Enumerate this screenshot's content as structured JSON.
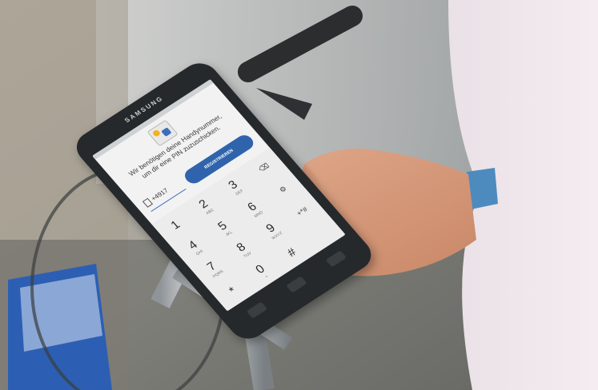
{
  "phone": {
    "brand": "SAMSUNG",
    "screen": {
      "message": "Wir benötigen deine Handynummer, um dir eine PIN zuzuschicken.",
      "phone_input_value": "+4917",
      "register_button": "REGISTRIEREN",
      "keypad": [
        {
          "main": "1",
          "sub": ""
        },
        {
          "main": "2",
          "sub": "ABC"
        },
        {
          "main": "3",
          "sub": "DEF"
        },
        {
          "main": "⌫",
          "sub": ""
        },
        {
          "main": "4",
          "sub": "GHI"
        },
        {
          "main": "5",
          "sub": "JKL"
        },
        {
          "main": "6",
          "sub": "MNO"
        },
        {
          "main": "⚙",
          "sub": ""
        },
        {
          "main": "7",
          "sub": "PQRS"
        },
        {
          "main": "8",
          "sub": "TUV"
        },
        {
          "main": "9",
          "sub": "WXYZ"
        },
        {
          "main": "+*#",
          "sub": ""
        },
        {
          "main": "*",
          "sub": ""
        },
        {
          "main": "0",
          "sub": "+"
        },
        {
          "main": "#",
          "sub": ""
        },
        {
          "main": "",
          "sub": ""
        }
      ]
    }
  },
  "colors": {
    "accent_blue": "#2f64ad",
    "logo_yellow": "#f2b21b"
  }
}
